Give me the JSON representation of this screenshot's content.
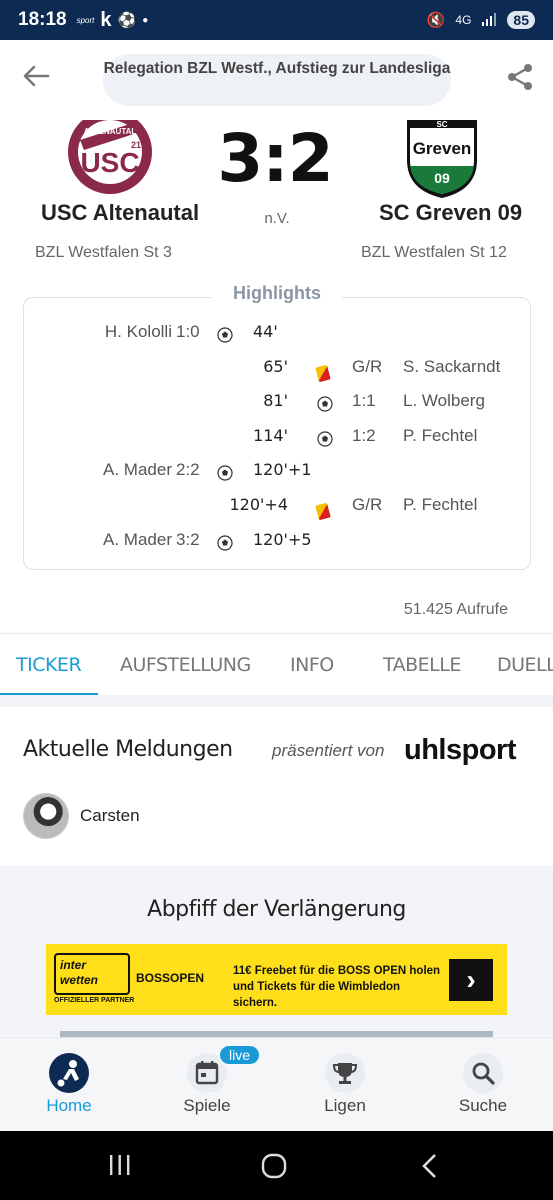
{
  "status_bar": {
    "time": "18:18",
    "app_sport": "sport",
    "app_k": "k",
    "network": "4G",
    "battery": "85"
  },
  "header": {
    "competition": "Relegation BZL Westf., Aufstieg zur Landesliga"
  },
  "match": {
    "home": {
      "name": "USC Altenautal",
      "league": "BZL Westfalen St 3",
      "crest_text": "USC",
      "crest_ring": "ALTENAUTAL",
      "crest_badge": "21"
    },
    "away": {
      "name": "SC Greven 09",
      "league": "BZL Westfalen St 12",
      "crest_text": "Greven",
      "crest_num": "09",
      "crest_top": "SC"
    },
    "score": "3:2",
    "note": "n.V."
  },
  "highlights": {
    "title": "Highlights",
    "events": [
      {
        "side": "home",
        "player": "H. Kololli",
        "score": "1:0",
        "type": "goal",
        "minute": "44'"
      },
      {
        "side": "away",
        "player": "S. Sackarndt",
        "score": "G/R",
        "type": "card",
        "minute": "65'"
      },
      {
        "side": "away",
        "player": "L. Wolberg",
        "score": "1:1",
        "type": "goal",
        "minute": "81'"
      },
      {
        "side": "away",
        "player": "P. Fechtel",
        "score": "1:2",
        "type": "goal",
        "minute": "114'"
      },
      {
        "side": "home",
        "player": "A. Mader",
        "score": "2:2",
        "type": "goal",
        "minute": "120'+1"
      },
      {
        "side": "away",
        "player": "P. Fechtel",
        "score": "G/R",
        "type": "card",
        "minute": "120'+4"
      },
      {
        "side": "home",
        "player": "A. Mader",
        "score": "3:2",
        "type": "goal",
        "minute": "120'+5"
      }
    ]
  },
  "views": "51.425 Aufrufe",
  "tabs": [
    "TICKER",
    "AUFSTELLUNG",
    "INFO",
    "TABELLE",
    "DUELLE"
  ],
  "news": {
    "title": "Aktuelle Meldungen",
    "presented_by": "präsentiert von",
    "sponsor": "uhlsport",
    "author": "Carsten",
    "entry_title": "Abpfiff der Verlängerung"
  },
  "ad": {
    "logo": "inter wetten",
    "partner": "OFFIZIELLER PARTNER",
    "event": "BOSSOPEN",
    "text": "11€ Freebet für die BOSS OPEN holen und Tickets für die Wimbledon sichern."
  },
  "bottom_nav": [
    {
      "label": "Home",
      "icon": "player-icon",
      "active": true
    },
    {
      "label": "Spiele",
      "icon": "calendar-icon",
      "badge": "live"
    },
    {
      "label": "Ligen",
      "icon": "trophy-icon"
    },
    {
      "label": "Suche",
      "icon": "search-icon"
    }
  ],
  "colors": {
    "accent": "#1a9bd6",
    "status_bar": "#0d2a52",
    "ad_bg": "#ffdf1a"
  }
}
